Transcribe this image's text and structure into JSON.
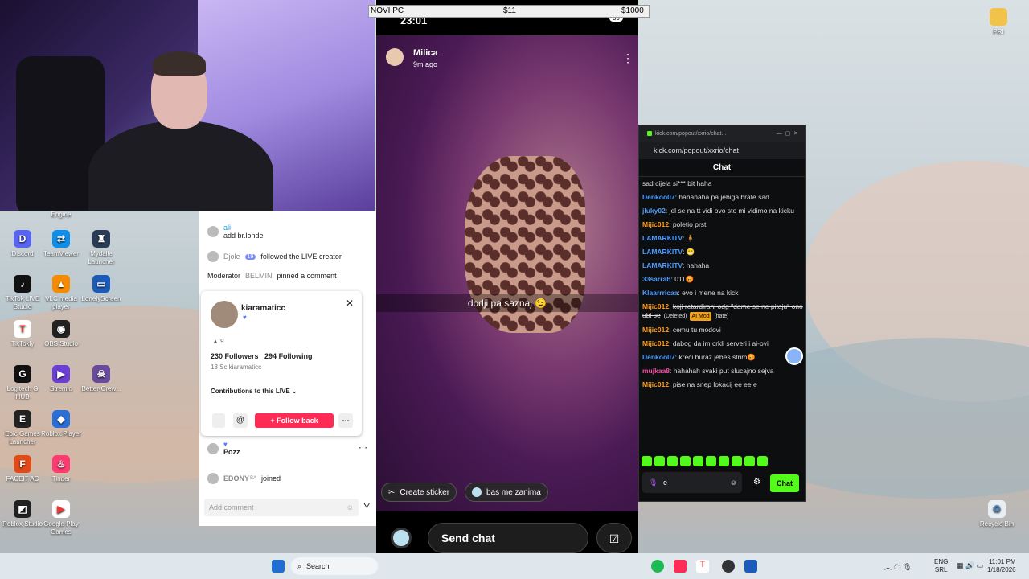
{
  "overlay_bar": {
    "name": "NOVI PC",
    "price1": "$11",
    "price2": "$1000"
  },
  "desktop": {
    "icons_left": [
      {
        "label": "Discord",
        "color": "#5865f2",
        "glyph": "D"
      },
      {
        "label": "TeamViewer",
        "color": "#0e8ee9",
        "glyph": "⇄"
      },
      {
        "label": "Mydalle Launcher",
        "color": "#2a3b55",
        "glyph": "♜"
      },
      {
        "label": "TikTok LIVE Studio",
        "color": "#111",
        "glyph": "♪"
      },
      {
        "label": "VLC media player",
        "color": "#f48b00",
        "glyph": "▲"
      },
      {
        "label": "LonelyScreen",
        "color": "#1d5bb8",
        "glyph": "▭"
      },
      {
        "label": "TikTokly",
        "color": "#fff",
        "glyph": "T"
      },
      {
        "label": "OBS Studio",
        "color": "#222",
        "glyph": "◉"
      },
      {
        "label": "Logitech G HUB",
        "color": "#111",
        "glyph": "G"
      },
      {
        "label": "Stremio",
        "color": "#6b3fd4",
        "glyph": "▶"
      },
      {
        "label": "Better-Crew...",
        "color": "#6a4a9c",
        "glyph": "☠"
      },
      {
        "label": "Epic Games Launcher",
        "color": "#222",
        "glyph": "E"
      },
      {
        "label": "Roblox Player",
        "color": "#2a6fd6",
        "glyph": "◆"
      },
      {
        "label": "FACEIT AC",
        "color": "#e04b1a",
        "glyph": "F"
      },
      {
        "label": "Tinder",
        "color": "#fe3c72",
        "glyph": "♨"
      },
      {
        "label": "Roblox Studio",
        "color": "#222",
        "glyph": "◩"
      },
      {
        "label": "Google Play Games",
        "color": "#fff",
        "glyph": "▶"
      }
    ],
    "engine_label": "Engine",
    "pr_label": "PRI",
    "recycle_label": "Recycle Bin"
  },
  "tiktok_panel": {
    "rows": [
      {
        "user": "ali",
        "text": "add br.londe"
      },
      {
        "user": "Djole",
        "level": "19",
        "text": "followed the LIVE creator"
      },
      {
        "user": "Moderator",
        "mod": "BELMIN",
        "text": "pinned a comment"
      }
    ],
    "profile": {
      "name": "kiaramaticc",
      "badge": "9",
      "followers": "230 Followers",
      "following": "294 Following",
      "sc": "18 Sc kiaramaticc",
      "contributions": "Contributions to this LIVE",
      "follow_back": "Follow back"
    },
    "comment": {
      "text": "Pozz"
    },
    "join": {
      "user": "EDONY",
      "country": "BA",
      "action": "joined"
    },
    "add_comment_placeholder": "Add comment"
  },
  "phone": {
    "time": "23:01",
    "battery": "39",
    "user": "Milica",
    "ago": "9m ago",
    "caption": "dodji pa saznaj 😉",
    "create_sticker": "Create sticker",
    "reply_pill": "bas me zanima",
    "send_chat": "Send chat"
  },
  "kick": {
    "window_title": "kick.com/popout/xxrio/chat...",
    "url": "kick.com/popout/xxrio/chat",
    "header": "Chat",
    "messages": [
      {
        "user": "",
        "color": "#ddd",
        "text": "sad cijela si*** bit haha"
      },
      {
        "user": "Denkoo07",
        "color": "#4a9cff",
        "text": "hahahaha pa jebiga brate sad"
      },
      {
        "user": "jluky02",
        "color": "#4a9cff",
        "text": "jel se na tt vidi ovo sto mi vidimo na kicku"
      },
      {
        "user": "Mijic012",
        "color": "#ff9a1a",
        "text": "poletio prst"
      },
      {
        "user": "LAMARKITV",
        "color": "#4a9cff",
        "text": "🧍"
      },
      {
        "user": "LAMARKITV",
        "color": "#4a9cff",
        "text": "😁"
      },
      {
        "user": "LAMARKITV",
        "color": "#4a9cff",
        "text": "hahaha"
      },
      {
        "user": "33sarrah",
        "color": "#4a9cff",
        "text": "011😡"
      },
      {
        "user": "Klaarrricaa",
        "color": "#4a9cff",
        "text": "evo i mene na kick"
      },
      {
        "user": "Mijic012",
        "color": "#ff9a1a",
        "text": "koji retardirani odg \"dame se ne pitaju\" ono ubi se",
        "deleted": "(Deleted)",
        "aimod": "AI Mod",
        "hate": "[hate]"
      },
      {
        "user": "Mijic012",
        "color": "#ff9a1a",
        "text": "cemu tu modovi"
      },
      {
        "user": "Mijic012",
        "color": "#ff9a1a",
        "text": "dabog da im crkli serveri i ai-ovi"
      },
      {
        "user": "Denkoo07",
        "color": "#4a9cff",
        "text": "kreci buraz jebes strim😡"
      },
      {
        "user": "mujkaa8",
        "color": "#ff4aa8",
        "text": "hahahah svaki put slucajno sejva"
      },
      {
        "user": "Mijic012",
        "color": "#ff9a1a",
        "text": "pise na snep lokacij ee ee e"
      }
    ],
    "input_value": "e",
    "chat_button": "Chat"
  },
  "taskbar": {
    "search": "Search",
    "lang": "ENG",
    "region": "SRL",
    "time": "11:01 PM",
    "date": "1/18/2026"
  }
}
